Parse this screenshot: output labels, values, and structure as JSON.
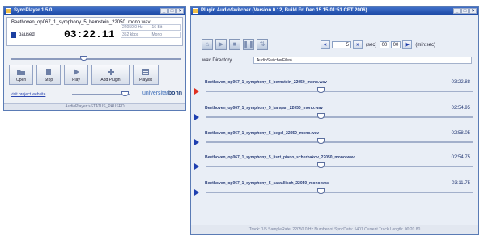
{
  "syncplayer": {
    "title": "SyncPlayer 1.5.0",
    "track_name": "Beethoven_op067_1_symphony_5_bernstein_22050_mono.wav",
    "status": "paused",
    "time": "03:22.11",
    "meta": {
      "freq": "22050.0 Hz",
      "bits": "16 Bit",
      "rate": "352 kbps",
      "channels": "Mono"
    },
    "buttons": {
      "open": "Open",
      "stop": "Stop",
      "play": "Play",
      "add_plugin": "Add Plugin",
      "playlist": "Playlist"
    },
    "position_fraction": 0.43,
    "volume_fraction": 0.9,
    "visit_link": "visit project website",
    "brand": {
      "text": "universität",
      "bold": "bonn"
    },
    "statusbar": "AudioPlayer:>STATUS_PAUSED"
  },
  "audioswitcher": {
    "title": "Plugin AudioSwitcher (Version 0.12, Build Fri Dec 15 15:01:51 CET 2006)",
    "jump_seconds": "5",
    "sec_label": "(sec)",
    "time_field": {
      "h": "00",
      "m": "00"
    },
    "msec_label": "(min:sec)",
    "wav_dir_label": "wav Directory",
    "wav_dir_value": "AudioSwitcherFiles\\",
    "tracks": [
      {
        "name": "Beethoven_op067_1_symphony_5_bernstein_22050_mono.wav",
        "duration": "03:22.88",
        "position": 0.43,
        "active": true
      },
      {
        "name": "Beethoven_op067_1_symphony_5_karajan_22050_mono.wav",
        "duration": "02:54.95",
        "position": 0.43,
        "active": false
      },
      {
        "name": "Beethoven_op067_1_symphony_5_kegel_22050_mono.wav",
        "duration": "02:58.05",
        "position": 0.43,
        "active": false
      },
      {
        "name": "Beethoven_op067_1_symphony_5_liszt_piano_scherbakov_22050_mono.wav",
        "duration": "02:54.75",
        "position": 0.43,
        "active": false
      },
      {
        "name": "Beethoven_op067_1_symphony_5_sawallisch_22050_mono.wav",
        "duration": "03:11.75",
        "position": 0.43,
        "active": false
      }
    ],
    "statusbar": "Track: 1/5   SampleRate: 22050.0 Hz   Number of SyncData: 5401   Current Track Length: 00:20.80"
  },
  "colors": {
    "accent": "#1e3fb0",
    "active_play": "#e03020"
  }
}
